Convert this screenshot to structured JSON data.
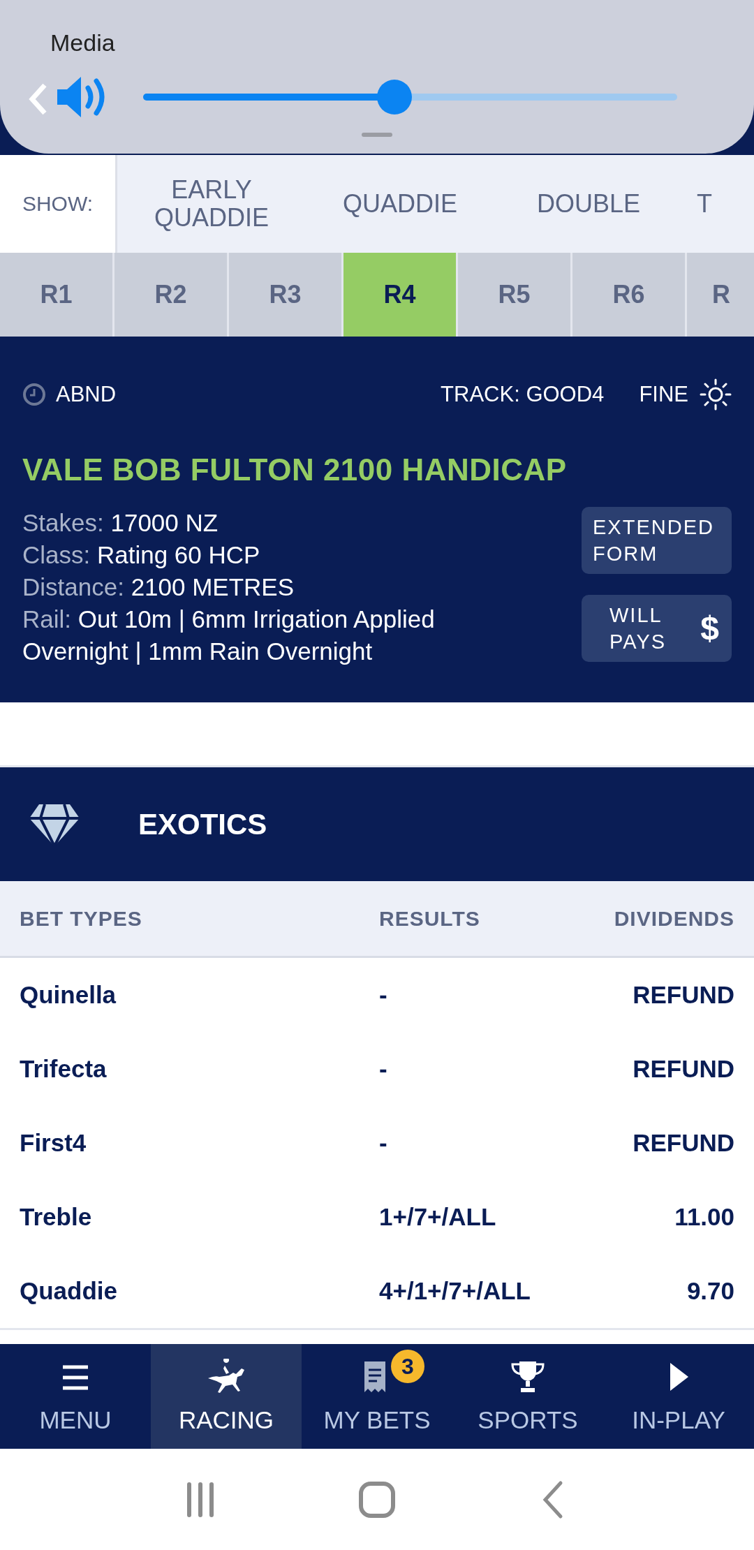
{
  "volume_panel": {
    "title": "Media",
    "level": 0.47
  },
  "show_filter": {
    "label": "SHOW:",
    "options": [
      {
        "label": "EARLY QUADDIE"
      },
      {
        "label": "QUADDIE"
      },
      {
        "label": "DOUBLE"
      },
      {
        "label": "T"
      }
    ]
  },
  "race_tabs": [
    {
      "label": "R1",
      "selected": false
    },
    {
      "label": "R2",
      "selected": false
    },
    {
      "label": "R3",
      "selected": false
    },
    {
      "label": "R4",
      "selected": true
    },
    {
      "label": "R5",
      "selected": false
    },
    {
      "label": "R6",
      "selected": false
    },
    {
      "label": "R",
      "selected": false
    }
  ],
  "race": {
    "status": "ABND",
    "track": "TRACK: GOOD4",
    "weather": "FINE",
    "name": "VALE BOB FULTON 2100 HANDICAP",
    "details": [
      {
        "label": "Stakes:",
        "value": "17000 NZ"
      },
      {
        "label": "Class:",
        "value": "Rating 60 HCP"
      },
      {
        "label": "Distance:",
        "value": "2100 METRES"
      },
      {
        "label": "Rail:",
        "value": "Out 10m | 6mm Irrigation Applied Overnight | 1mm Rain Overnight"
      }
    ],
    "buttons": [
      {
        "kind": "text",
        "label": "EXTENDED FORM"
      },
      {
        "kind": "dollar",
        "label": "WILL PAYS",
        "symbol": "$"
      }
    ]
  },
  "exotics": {
    "title": "EXOTICS",
    "columns": [
      "BET TYPES",
      "RESULTS",
      "DIVIDENDS"
    ],
    "rows": [
      [
        "Quinella",
        "-",
        "REFUND"
      ],
      [
        "Trifecta",
        "-",
        "REFUND"
      ],
      [
        "First4",
        "-",
        "REFUND"
      ],
      [
        "Treble",
        "1+/7+/ALL",
        "11.00"
      ],
      [
        "Quaddie",
        "4+/1+/7+/ALL",
        "9.70"
      ]
    ]
  },
  "bottom_nav": [
    {
      "kind": "menu",
      "label": "MENU",
      "selected": false
    },
    {
      "kind": "racing",
      "label": "RACING",
      "selected": true
    },
    {
      "kind": "bets",
      "label": "MY BETS",
      "selected": false,
      "badge": "3"
    },
    {
      "kind": "sports",
      "label": "SPORTS",
      "selected": false
    },
    {
      "kind": "play",
      "label": "IN-PLAY",
      "selected": false
    }
  ]
}
